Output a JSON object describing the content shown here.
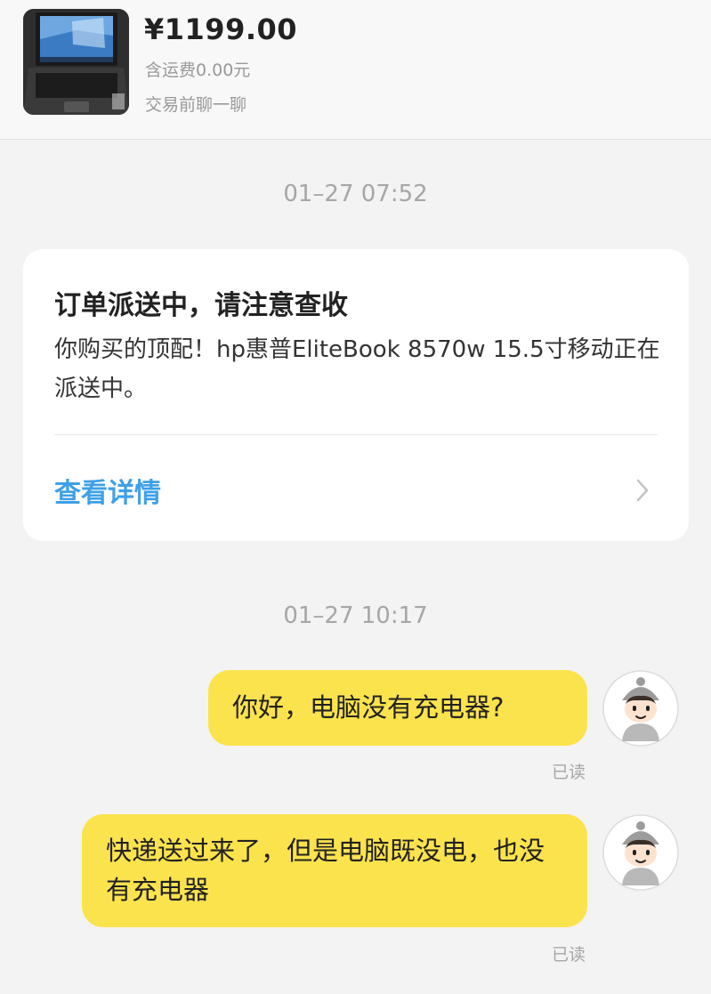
{
  "product": {
    "price": "¥1199.00",
    "shipping": "含运费0.00元",
    "chat_link": "交易前聊一聊",
    "thumbnail_icon": "laptop-photo"
  },
  "timestamps": [
    "01–27 07:52",
    "01–27 10:17"
  ],
  "order_card": {
    "title": "订单派送中，请注意查收",
    "body": "你购买的顶配！hp惠普EliteBook 8570w 15.5寸移动正在派送中。",
    "link": "查看详情",
    "link_color": "#3ea0e8",
    "chevron_icon": "chevron-right-icon"
  },
  "messages": [
    {
      "text": "你好，电脑没有充电器?",
      "status": "已读"
    },
    {
      "text": "快递送过来了，但是电脑既没电，也没有充电器",
      "status": "已读"
    }
  ],
  "colors": {
    "bubble": "#fbe34d",
    "background": "#f3f3f3",
    "muted_text": "#a6a6a6"
  }
}
